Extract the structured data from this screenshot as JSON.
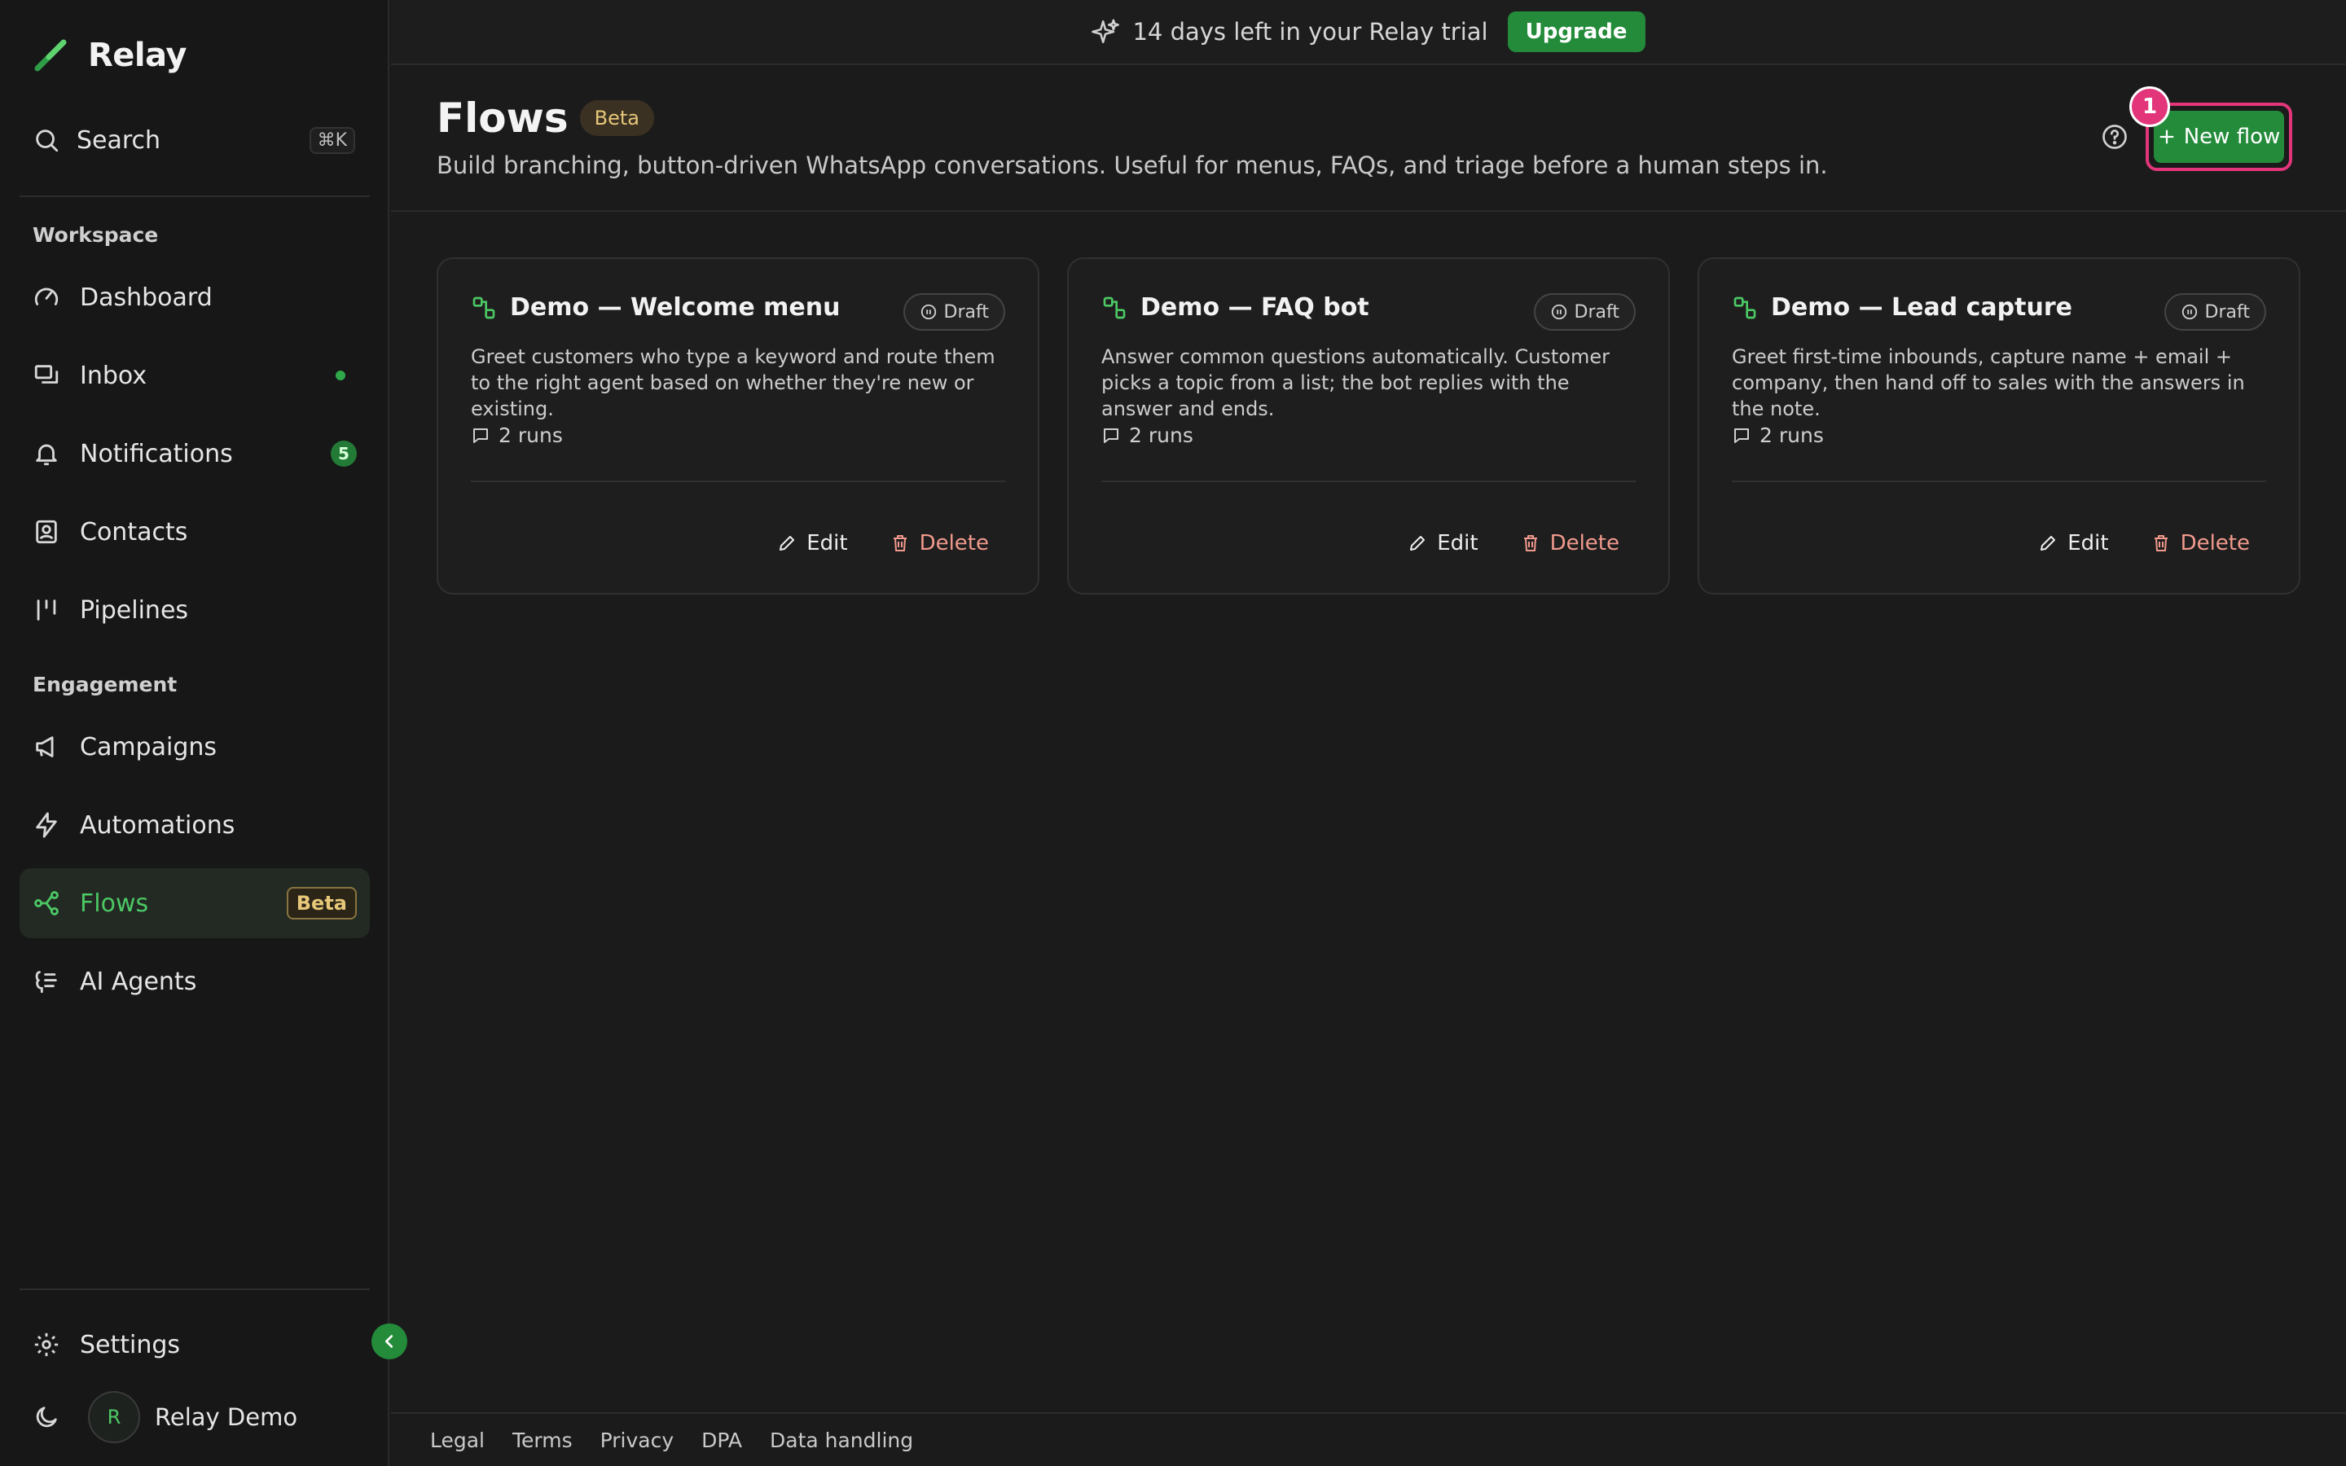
{
  "app": {
    "name": "Relay",
    "accent_color": "#238b3a",
    "highlight_color": "#e2357a"
  },
  "banner": {
    "text": "14 days left in your Relay trial",
    "upgrade_label": "Upgrade",
    "icon": "sparkles-icon"
  },
  "sidebar": {
    "search_label": "Search",
    "search_shortcut": "⌘K",
    "sections": {
      "workspace": "Workspace",
      "engagement": "Engagement"
    },
    "items": [
      {
        "label": "Dashboard",
        "icon": "gauge-icon"
      },
      {
        "label": "Inbox",
        "icon": "inbox-icon",
        "indicator": "dot"
      },
      {
        "label": "Notifications",
        "icon": "bell-icon",
        "badge": "5"
      },
      {
        "label": "Contacts",
        "icon": "contact-icon"
      },
      {
        "label": "Pipelines",
        "icon": "pipeline-icon"
      },
      {
        "label": "Campaigns",
        "icon": "megaphone-icon"
      },
      {
        "label": "Automations",
        "icon": "bolt-icon"
      },
      {
        "label": "Flows",
        "icon": "flow-icon",
        "badge": "Beta",
        "active": true
      },
      {
        "label": "AI Agents",
        "icon": "brain-icon"
      }
    ],
    "settings_label": "Settings",
    "user": {
      "initial": "R",
      "name": "Relay Demo"
    }
  },
  "header": {
    "title": "Flows",
    "title_badge": "Beta",
    "subtitle": "Build branching, button-driven WhatsApp conversations. Useful for menus, FAQs, and triage before a human steps in.",
    "new_flow_label": "New flow",
    "step_marker": "1"
  },
  "cards": [
    {
      "title": "Demo — Welcome menu",
      "status": "Draft",
      "description": "Greet customers who type a keyword and route them to the right agent based on whether they're new or existing.",
      "runs": "2 runs",
      "edit_label": "Edit",
      "delete_label": "Delete"
    },
    {
      "title": "Demo — FAQ bot",
      "status": "Draft",
      "description": "Answer common questions automatically. Customer picks a topic from a list; the bot replies with the answer and ends.",
      "runs": "2 runs",
      "edit_label": "Edit",
      "delete_label": "Delete"
    },
    {
      "title": "Demo — Lead capture",
      "status": "Draft",
      "description": "Greet first-time inbounds, capture name + email + company, then hand off to sales with the answers in the note.",
      "runs": "2 runs",
      "edit_label": "Edit",
      "delete_label": "Delete"
    }
  ],
  "footer": {
    "links": [
      "Legal",
      "Terms",
      "Privacy",
      "DPA",
      "Data handling"
    ]
  }
}
